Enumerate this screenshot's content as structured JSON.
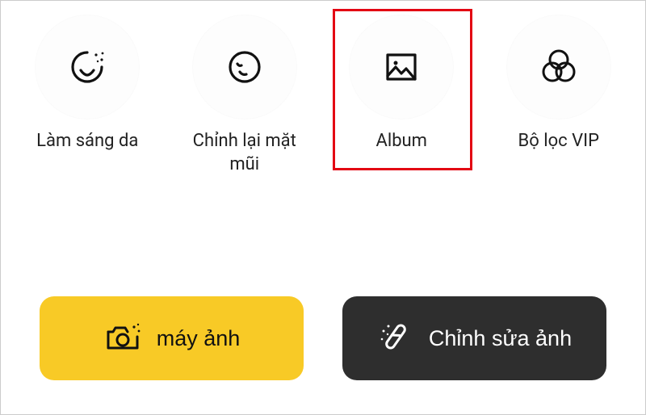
{
  "features": [
    {
      "label": "Làm sáng da",
      "icon": "smile-sparkle-icon"
    },
    {
      "label": "Chỉnh lại mặt mũi",
      "icon": "face-wink-icon"
    },
    {
      "label": "Album",
      "icon": "image-icon"
    },
    {
      "label": "Bộ lọc VIP",
      "icon": "overlap-circles-icon"
    }
  ],
  "actions": {
    "camera_label": "máy ảnh",
    "edit_label": "Chỉnh sửa ảnh"
  },
  "highlighted_feature_index": 2,
  "colors": {
    "highlight": "#e30613",
    "camera_btn": "#f8ca26",
    "edit_btn": "#2e2e2e"
  }
}
